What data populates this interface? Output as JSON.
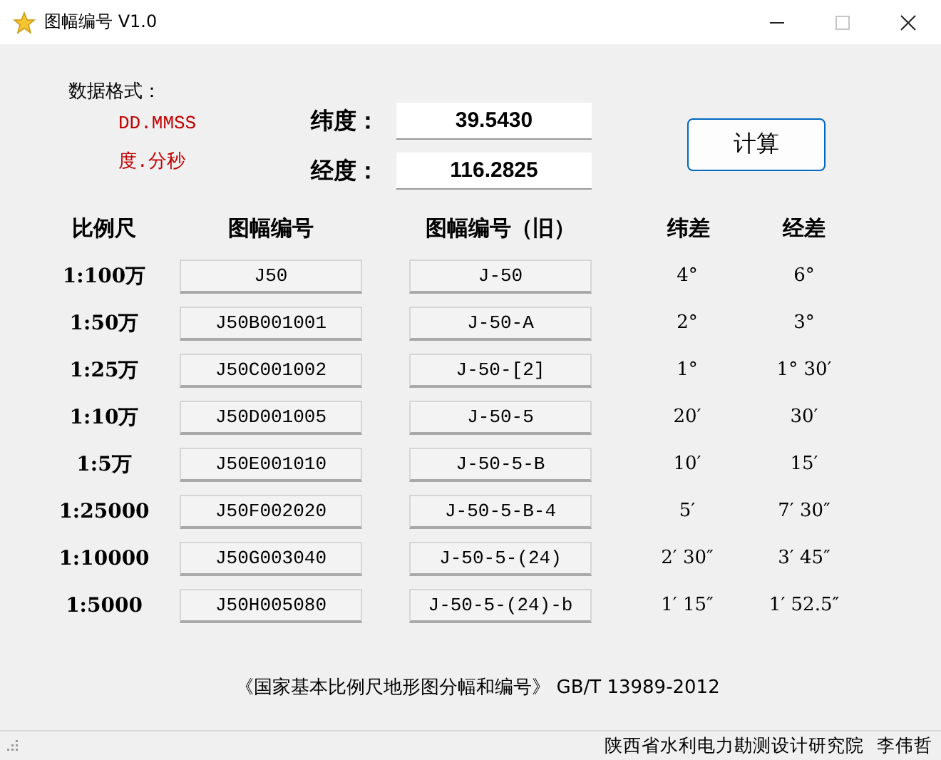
{
  "window": {
    "title": "图幅编号 V1.0",
    "controls": [
      {
        "kind": "minimize",
        "disabled": false
      },
      {
        "kind": "maximize",
        "disabled": true
      },
      {
        "kind": "close",
        "disabled": false
      }
    ]
  },
  "format": {
    "label": "数据格式：",
    "lines": [
      "DD.MMSS",
      "度.分秒"
    ]
  },
  "inputs": [
    {
      "label": "纬度：",
      "value": "39.5430"
    },
    {
      "label": "经度：",
      "value": "116.2825"
    }
  ],
  "compute_button": "计算",
  "table": {
    "columns": [
      "比例尺",
      "图幅编号",
      "图幅编号（旧）",
      "纬差",
      "经差"
    ],
    "rows": [
      {
        "scale": "1:100万",
        "code": "J50",
        "old_code": "J-50",
        "lat_diff": "4°",
        "lon_diff": "6°"
      },
      {
        "scale": "1:50万",
        "code": "J50B001001",
        "old_code": "J-50-A",
        "lat_diff": "2°",
        "lon_diff": "3°"
      },
      {
        "scale": "1:25万",
        "code": "J50C001002",
        "old_code": "J-50-[2]",
        "lat_diff": "1°",
        "lon_diff": "1° 30′"
      },
      {
        "scale": "1:10万",
        "code": "J50D001005",
        "old_code": "J-50-5",
        "lat_diff": "20′",
        "lon_diff": "30′"
      },
      {
        "scale": "1:5万",
        "code": "J50E001010",
        "old_code": "J-50-5-B",
        "lat_diff": "10′",
        "lon_diff": "15′"
      },
      {
        "scale": "1:25000",
        "code": "J50F002020",
        "old_code": "J-50-5-B-4",
        "lat_diff": "5′",
        "lon_diff": "7′ 30″"
      },
      {
        "scale": "1:10000",
        "code": "J50G003040",
        "old_code": "J-50-5-(24)",
        "lat_diff": "2′ 30″",
        "lon_diff": "3′ 45″"
      },
      {
        "scale": "1:5000",
        "code": "J50H005080",
        "old_code": "J-50-5-(24)-b",
        "lat_diff": "1′ 15″",
        "lon_diff": "1′ 52.5″"
      }
    ]
  },
  "footnote": "《国家基本比例尺地形图分幅和编号》 GB/T 13989-2012",
  "status_bar": {
    "organization": "陕西省水利电力勘测设计研究院",
    "author": "李伟哲"
  }
}
